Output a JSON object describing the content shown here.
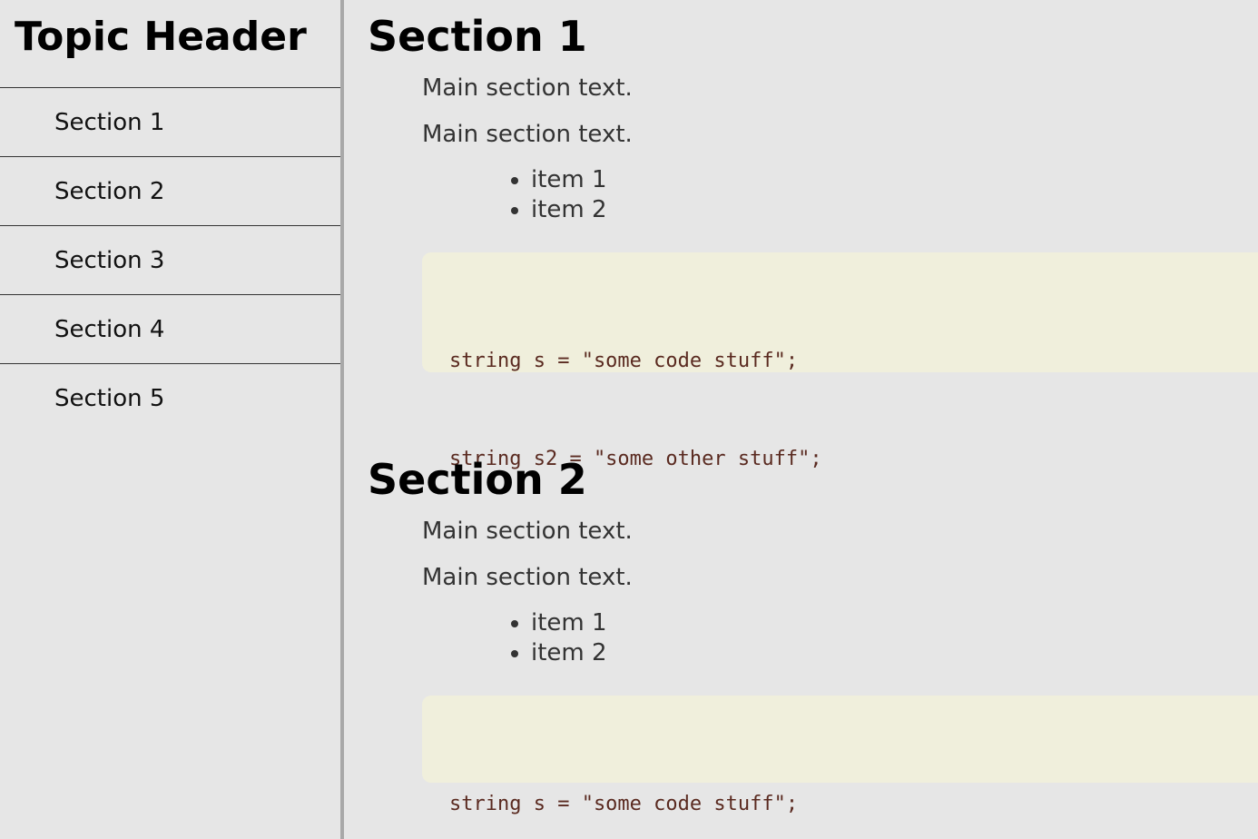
{
  "sidebar": {
    "title": "Topic Header",
    "items": [
      {
        "label": "Section 1"
      },
      {
        "label": "Section 2"
      },
      {
        "label": "Section 3"
      },
      {
        "label": "Section 4"
      },
      {
        "label": "Section 5"
      }
    ]
  },
  "main": {
    "sections": [
      {
        "title": "Section 1",
        "paragraphs": [
          "Main section text.",
          "Main section text."
        ],
        "list": [
          "item 1",
          "item 2"
        ],
        "code": [
          "string s = \"some code stuff\";",
          "string s2 = \"some other stuff\";"
        ]
      },
      {
        "title": "Section 2",
        "paragraphs": [
          "Main section text.",
          "Main section text."
        ],
        "list": [
          "item 1",
          "item 2"
        ],
        "code": [
          "string s = \"some code stuff\";"
        ]
      }
    ]
  },
  "colors": {
    "background": "#e6e6e6",
    "code_background": "#f0efdc",
    "code_text": "#5a2a20",
    "sidebar_border": "#a8a8a8"
  }
}
